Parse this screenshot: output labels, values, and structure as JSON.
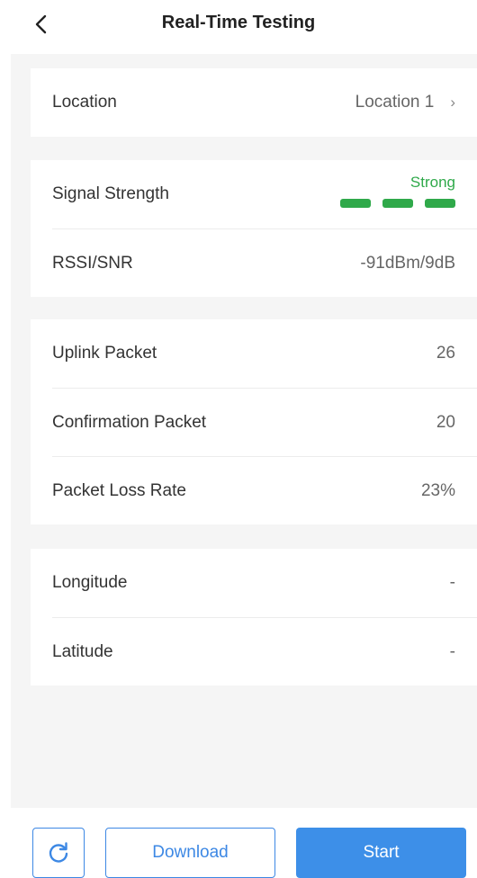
{
  "header": {
    "title": "Real-Time Testing",
    "back_icon": "chevron-left-icon"
  },
  "location": {
    "label": "Location",
    "value": "Location 1",
    "icon": "chevron-right-icon"
  },
  "signal": {
    "label": "Signal Strength",
    "status": "Strong",
    "bars_total": 3,
    "bars_active": 3,
    "color": "#2fa94a",
    "rssi_label": "RSSI/SNR",
    "rssi_value": "-91dBm/9dB"
  },
  "packets": {
    "uplink_label": "Uplink Packet",
    "uplink_value": "26",
    "confirm_label": "Confirmation Packet",
    "confirm_value": "20",
    "loss_label": "Packet Loss Rate",
    "loss_value": "23%"
  },
  "gps": {
    "longitude_label": "Longitude",
    "longitude_value": "-",
    "latitude_label": "Latitude",
    "latitude_value": "-"
  },
  "footer": {
    "refresh_icon": "refresh-icon",
    "download_label": "Download",
    "start_label": "Start",
    "accent": "#3d88e4"
  }
}
